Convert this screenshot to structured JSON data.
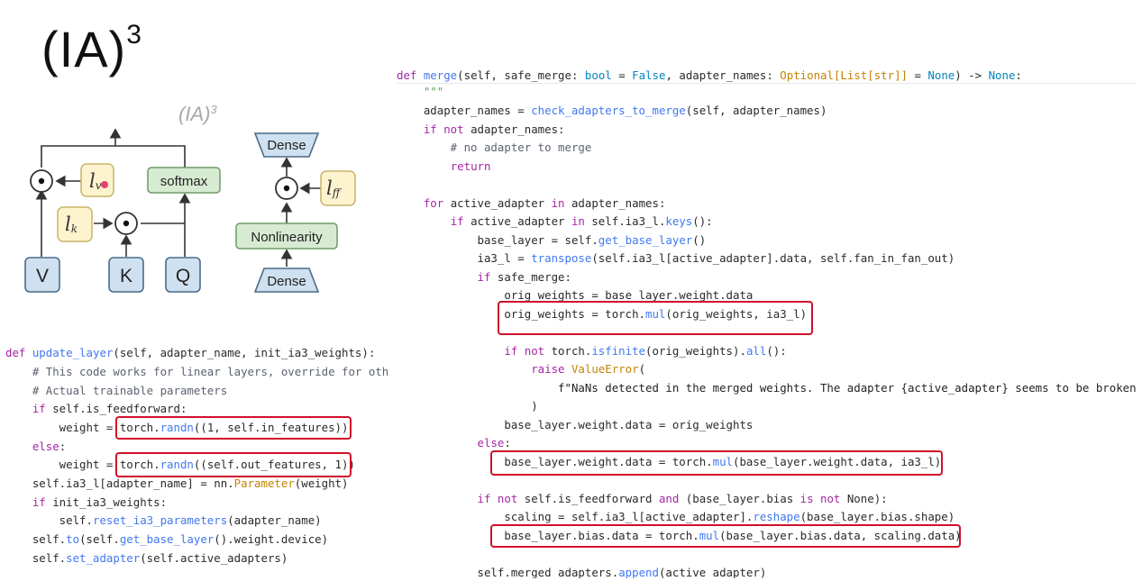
{
  "slide": {
    "title_main": "(IA)",
    "title_sup": "3"
  },
  "diagram": {
    "label": "(IA)",
    "label_sup": "3",
    "boxes": {
      "lv": "l",
      "lv_sub": "v",
      "lk": "l",
      "lk_sub": "k",
      "lff": "l",
      "lff_sub": "ff",
      "softmax": "softmax",
      "v": "V",
      "k": "K",
      "q": "Q",
      "dense_top": "Dense",
      "dense_bottom": "Dense",
      "nonlinearity": "Nonlinearity"
    },
    "colors": {
      "yellow_fill": "#fdf3cf",
      "yellow_stroke": "#c9b46a",
      "green_fill": "#d7ebd2",
      "green_stroke": "#6f9b66",
      "blue_fill": "#cfe0f0",
      "blue_stroke": "#4a6b8a",
      "marker": "#e2446a",
      "highlight": "#d0102a"
    }
  },
  "left_code": {
    "l1": [
      "def ",
      "update_layer",
      "(self, adapter_name, init_ia3_weights):"
    ],
    "l2": "    # This code works for linear layers, override for other layer types",
    "l3": "    # Actual trainable parameters",
    "l4": [
      "    ",
      "if",
      " self.is_feedforward:"
    ],
    "l5": [
      "        weight = ",
      "torch.",
      "randn",
      "((1, self.in_features))"
    ],
    "l6": [
      "    ",
      "else",
      ":"
    ],
    "l7": [
      "        weight = ",
      "torch.",
      "randn",
      "((self.out_features, 1))"
    ],
    "l8": [
      "    self.ia3_l[adapter_name] = nn.",
      "Parameter",
      "(weight)"
    ],
    "l9": [
      "    ",
      "if",
      " init_ia3_weights:"
    ],
    "l10": [
      "        self.",
      "reset_ia3_parameters",
      "(adapter_name)"
    ],
    "l11": [
      "    self.",
      "to",
      "(self.",
      "get_base_layer",
      "().weight.device)"
    ],
    "l12": [
      "    self.",
      "set_adapter",
      "(self.active_adapters)"
    ]
  },
  "right_code": {
    "r1": [
      "def ",
      "merge",
      "(self, safe_merge: ",
      "bool",
      " = ",
      "False",
      ", adapter_names: ",
      "Optional[List[str]]",
      " = ",
      "None",
      ") -> ",
      "None",
      ":"
    ],
    "r2": "    \"\"\"",
    "r3": [
      "    adapter_names = ",
      "check_adapters_to_merge",
      "(self, adapter_names)"
    ],
    "r4": [
      "    ",
      "if not",
      " adapter_names:"
    ],
    "r5": "        # no adapter to merge",
    "r6": [
      "        ",
      "return"
    ],
    "r7": [
      "    ",
      "for",
      " active_adapter ",
      "in",
      " adapter_names:"
    ],
    "r8": [
      "        ",
      "if",
      " active_adapter ",
      "in",
      " self.ia3_l.",
      "keys",
      "():"
    ],
    "r9": [
      "            base_layer = self.",
      "get_base_layer",
      "()"
    ],
    "r10": [
      "            ia3_l = ",
      "transpose",
      "(self.ia3_l[active_adapter].data, self.fan_in_fan_out)"
    ],
    "r11": [
      "            ",
      "if",
      " safe_merge:"
    ],
    "r12": "                orig_weights = base_layer.weight.data",
    "r13": [
      "                orig_weights = torch.",
      "mul",
      "(orig_weights, ia3_l)"
    ],
    "r14": [
      "                ",
      "if not",
      " torch.",
      "isfinite",
      "(orig_weights).",
      "all",
      "():"
    ],
    "r15": [
      "                    ",
      "raise ",
      "ValueError",
      "("
    ],
    "r16": "                        f\"NaNs detected in the merged weights. The adapter {active_adapter} seems to be broken\"",
    "r17": "                    )",
    "r18": "                base_layer.weight.data = orig_weights",
    "r19": [
      "            ",
      "else",
      ":"
    ],
    "r20": [
      "                base_layer.weight.data = torch.",
      "mul",
      "(base_layer.weight.data, ia3_l)"
    ],
    "r21": [
      "            ",
      "if not",
      " self.is_feedforward ",
      "and",
      " (base_layer.bias ",
      "is not",
      " None):"
    ],
    "r22": [
      "                scaling = self.ia3_l[active_adapter].",
      "reshape",
      "(base_layer.bias.shape)"
    ],
    "r23": [
      "                base_layer.bias.data = torch.",
      "mul",
      "(base_layer.bias.data, scaling.data)"
    ],
    "r24": [
      "            self.merged_adapters.",
      "append",
      "(active_adapter)"
    ]
  }
}
